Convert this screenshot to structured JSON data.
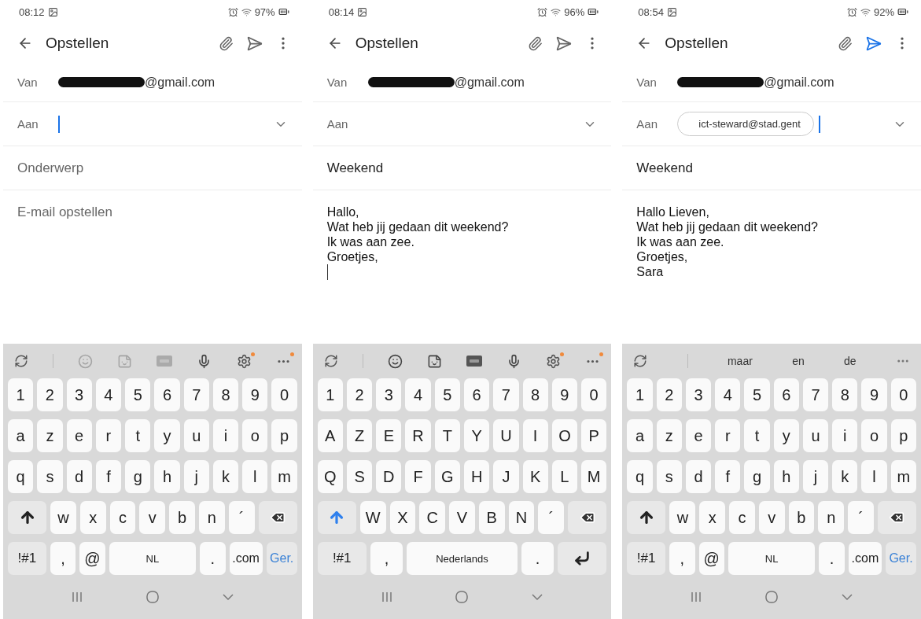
{
  "phones": [
    {
      "status": {
        "time": "08:12",
        "battery": "97%"
      },
      "title": "Opstellen",
      "send_enabled": false,
      "from": {
        "label": "Van",
        "address": "@gmail.com"
      },
      "to": {
        "label": "Aan",
        "cursor": true
      },
      "subject": {
        "placeholder": "Onderwerp"
      },
      "body": {
        "placeholder": "E-mail opstellen",
        "cursor": false
      },
      "keyboard": {
        "toolbar": {
          "kind": "tools",
          "dimmed": true
        },
        "number_keys": [
          "1",
          "2",
          "3",
          "4",
          "5",
          "6",
          "7",
          "8",
          "9",
          "0"
        ],
        "letter_rows": [
          [
            "a",
            "z",
            "e",
            "r",
            "t",
            "y",
            "u",
            "i",
            "o",
            "p"
          ],
          [
            "q",
            "s",
            "d",
            "f",
            "g",
            "h",
            "j",
            "k",
            "l",
            "m"
          ],
          [
            "w",
            "x",
            "c",
            "v",
            "b",
            "n",
            "´"
          ]
        ],
        "shift_active": false,
        "bottom_keys": [
          {
            "kind": "function",
            "label": "!#1"
          },
          {
            "kind": "char",
            "label": ","
          },
          {
            "kind": "char",
            "label": "@"
          },
          {
            "kind": "space",
            "label": "NL"
          },
          {
            "kind": "char",
            "label": "."
          },
          {
            "kind": "char",
            "label": ".com"
          },
          {
            "kind": "action",
            "label": "Ger."
          }
        ]
      }
    },
    {
      "status": {
        "time": "08:14",
        "battery": "96%"
      },
      "title": "Opstellen",
      "send_enabled": false,
      "from": {
        "label": "Van",
        "address": "@gmail.com"
      },
      "to": {
        "label": "Aan",
        "cursor": false
      },
      "subject": {
        "value": "Weekend"
      },
      "body": {
        "lines": [
          "Hallo,",
          "Wat heb jij gedaan dit weekend?",
          "Ik was aan zee.",
          "Groetjes,"
        ],
        "cursor": true
      },
      "keyboard": {
        "toolbar": {
          "kind": "tools",
          "dimmed": false
        },
        "number_keys": [
          "1",
          "2",
          "3",
          "4",
          "5",
          "6",
          "7",
          "8",
          "9",
          "0"
        ],
        "letter_rows": [
          [
            "A",
            "Z",
            "E",
            "R",
            "T",
            "Y",
            "U",
            "I",
            "O",
            "P"
          ],
          [
            "Q",
            "S",
            "D",
            "F",
            "G",
            "H",
            "J",
            "K",
            "L",
            "M"
          ],
          [
            "W",
            "X",
            "C",
            "V",
            "B",
            "N",
            "´"
          ]
        ],
        "shift_active": true,
        "bottom_keys": [
          {
            "kind": "function",
            "label": "!#1"
          },
          {
            "kind": "char",
            "label": ","
          },
          {
            "kind": "space",
            "label": "Nederlands"
          },
          {
            "kind": "char",
            "label": "."
          },
          {
            "kind": "enter"
          }
        ]
      }
    },
    {
      "status": {
        "time": "08:54",
        "battery": "92%"
      },
      "title": "Opstellen",
      "send_enabled": true,
      "from": {
        "label": "Van",
        "address": "@gmail.com"
      },
      "to": {
        "label": "Aan",
        "recipients": [
          "ict-steward@stad.gent"
        ],
        "cursor": true
      },
      "subject": {
        "value": "Weekend"
      },
      "body": {
        "lines": [
          "Hallo Lieven,",
          "Wat heb jij gedaan dit weekend?",
          "Ik was aan zee.",
          "Groetjes,",
          "Sara"
        ],
        "cursor": false
      },
      "keyboard": {
        "toolbar": {
          "kind": "suggestions",
          "words": [
            "maar",
            "en",
            "de"
          ]
        },
        "number_keys": [
          "1",
          "2",
          "3",
          "4",
          "5",
          "6",
          "7",
          "8",
          "9",
          "0"
        ],
        "letter_rows": [
          [
            "a",
            "z",
            "e",
            "r",
            "t",
            "y",
            "u",
            "i",
            "o",
            "p"
          ],
          [
            "q",
            "s",
            "d",
            "f",
            "g",
            "h",
            "j",
            "k",
            "l",
            "m"
          ],
          [
            "w",
            "x",
            "c",
            "v",
            "b",
            "n",
            "´"
          ]
        ],
        "shift_active": false,
        "bottom_keys": [
          {
            "kind": "function",
            "label": "!#1"
          },
          {
            "kind": "char",
            "label": ","
          },
          {
            "kind": "char",
            "label": "@"
          },
          {
            "kind": "space",
            "label": "NL"
          },
          {
            "kind": "char",
            "label": "."
          },
          {
            "kind": "char",
            "label": ".com"
          },
          {
            "kind": "action",
            "label": "Ger."
          }
        ]
      }
    }
  ]
}
